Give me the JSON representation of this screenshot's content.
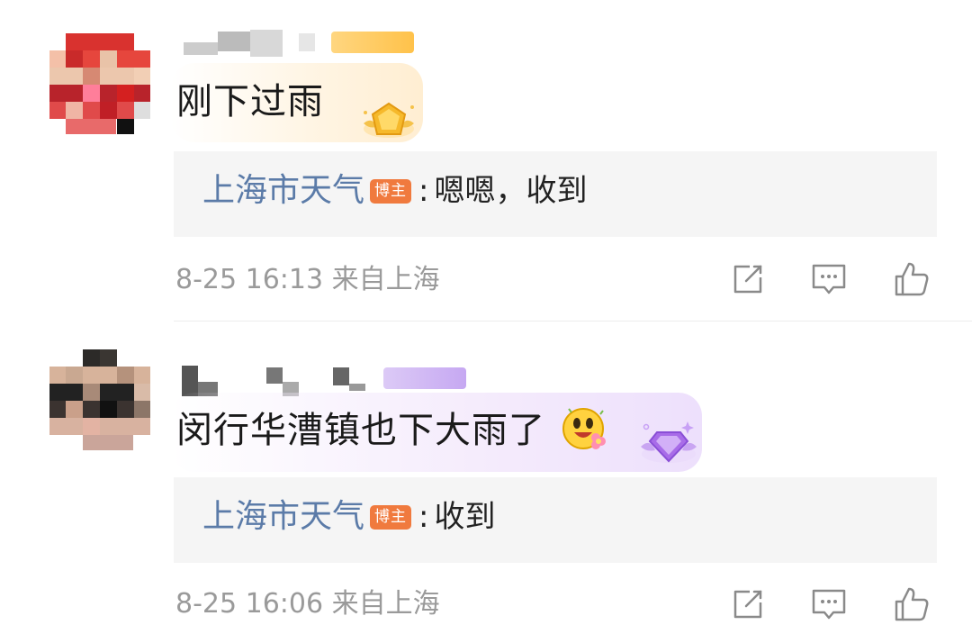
{
  "comments": [
    {
      "text": "刚下过雨",
      "reply": {
        "author": "上海市天气",
        "tag": "博主",
        "colon": ":",
        "text": "嗯嗯，收到"
      },
      "meta": {
        "time": "8-25 16:13",
        "location": "来自上海"
      },
      "badge_icon": "gold-gem-badge-icon"
    },
    {
      "text": "闵行华漕镇也下大雨了",
      "emoji_icon": "flower-smile-emoji-icon",
      "reply": {
        "author": "上海市天气",
        "tag": "博主",
        "colon": ":",
        "text": "收到"
      },
      "meta": {
        "time": "8-25 16:06",
        "location": "来自上海"
      },
      "badge_icon": "purple-diamond-badge-icon"
    }
  ],
  "actions": [
    "repost-icon",
    "comment-icon",
    "like-icon"
  ],
  "colors": {
    "reply_author": "#5b7ba8",
    "blogger_tag": "#f07a3e",
    "meta": "#9a9a9a",
    "reply_bg": "#f5f5f5",
    "comment_text": "#1a1a1a"
  }
}
